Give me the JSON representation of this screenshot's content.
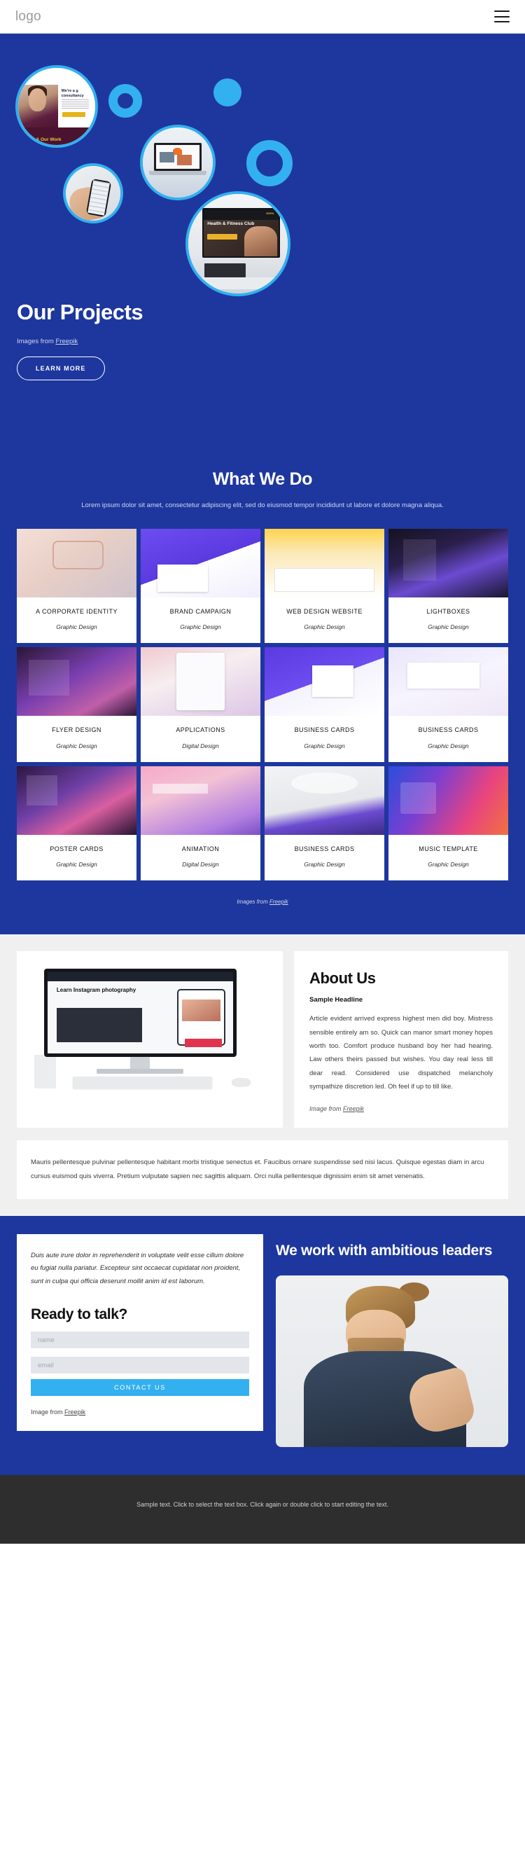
{
  "header": {
    "logo": "logo",
    "menu_icon": "hamburger-menu-icon"
  },
  "hero": {
    "title": "Our Projects",
    "credit_prefix": "Images from ",
    "credit_link": "Freepik",
    "button": "LEARN MORE",
    "circle_shot": {
      "headline": "We're a g\nconsultancy",
      "button": "READ MORE",
      "band_text": "Us & Our Work"
    },
    "circle_tv": {
      "brand": "ESPN",
      "title": "Health & Fitness Club"
    }
  },
  "works": {
    "title": "What We Do",
    "subtitle": "Lorem ipsum dolor sit amet, consectetur adipiscing elit, sed do eiusmod tempor incididunt ut labore et dolore magna aliqua.",
    "credit_prefix": "Images from ",
    "credit_link": "Freepik",
    "items": [
      {
        "name": "A CORPORATE IDENTITY",
        "category": "Graphic Design",
        "thumb": "t-corp"
      },
      {
        "name": "BRAND CAMPAIGN",
        "category": "Graphic Design",
        "thumb": "t-brand"
      },
      {
        "name": "WEB DESIGN WEBSITE",
        "category": "Graphic Design",
        "thumb": "t-web"
      },
      {
        "name": "LIGHTBOXES",
        "category": "Graphic Design",
        "thumb": "t-light"
      },
      {
        "name": "FLYER DESIGN",
        "category": "Graphic Design",
        "thumb": "t-flyer"
      },
      {
        "name": "APPLICATIONS",
        "category": "Digital Design",
        "thumb": "t-apps"
      },
      {
        "name": "BUSINESS CARDS",
        "category": "Graphic Design",
        "thumb": "t-bc1"
      },
      {
        "name": "BUSINESS CARDS",
        "category": "Graphic Design",
        "thumb": "t-bc2"
      },
      {
        "name": "POSTER CARDS",
        "category": "Graphic Design",
        "thumb": "t-poster"
      },
      {
        "name": "ANIMATION",
        "category": "Digital Design",
        "thumb": "t-anim"
      },
      {
        "name": "BUSINESS CARDS",
        "category": "Graphic Design",
        "thumb": "t-bc3"
      },
      {
        "name": "MUSIC TEMPLATE",
        "category": "Graphic Design",
        "thumb": "t-music"
      }
    ]
  },
  "about": {
    "title": "About Us",
    "headline": "Sample Headline",
    "body": "Article evident arrived express highest men did boy. Mistress sensible entirely am so. Quick can manor smart money hopes worth too. Comfort produce husband boy her had hearing. Law others theirs passed but wishes. You day real less till dear read. Considered use dispatched melancholy sympathize discretion led. Oh feel if up to till like.",
    "credit_prefix": "Image from ",
    "credit_link": "Freepik",
    "screen_headline": "Learn Instagram photography",
    "note": "Mauris pellentesque pulvinar pellentesque habitant morbi tristique senectus et. Faucibus ornare suspendisse sed nisi lacus. Quisque egestas diam in arcu cursus euismod quis viverra. Pretium vulputate sapien nec sagittis aliquam. Orci nulla pellentesque dignissim enim sit amet venenatis."
  },
  "contact": {
    "quote": "Duis aute irure dolor in reprehenderit in voluptate velit esse cillum dolore eu fugiat nulla pariatur. Excepteur sint occaecat cupidatat non proident, sunt in culpa qui officia deserunt mollit anim id est laborum.",
    "heading": "Ready to talk?",
    "name_placeholder": "name",
    "name_value": "",
    "email_placeholder": "email",
    "email_value": "",
    "submit": "CONTACT US",
    "credit_prefix": "Image from ",
    "credit_link": "Freepik",
    "right_title": "We work with ambitious leaders"
  },
  "footer": {
    "text": "Sample text. Click to select the text box. Click again or double click to start editing the text."
  },
  "colors": {
    "brand_blue": "#1e379e",
    "accent_cyan": "#33b0ef",
    "footer_dark": "#2e2e2e",
    "panel_gray": "#f0f0f0"
  }
}
